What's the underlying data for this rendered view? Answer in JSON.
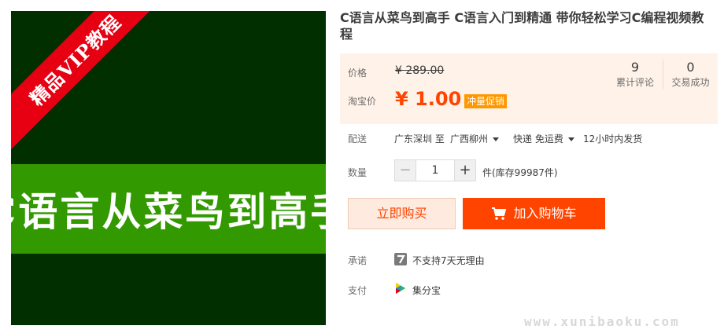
{
  "product_image": {
    "ribbon_text": "精品VIP教程",
    "banner_text": "C语言从菜鸟到高手"
  },
  "title": "C语言从菜鸟到高手 C语言入门到精通 带你轻松学习C编程视频教程",
  "price": {
    "price_label": "价格",
    "original_price": "¥ 289.00",
    "promo_label": "淘宝价",
    "promo_price": "¥ 1.00",
    "promo_tag": "冲量促销"
  },
  "stats": [
    {
      "value": "9",
      "label": "累计评论"
    },
    {
      "value": "0",
      "label": "交易成功"
    }
  ],
  "shipping": {
    "label": "配送",
    "from": "广东深圳 至",
    "to": "广西柳州",
    "method": "快递 免运费",
    "dispatch": "12小时内发货"
  },
  "quantity": {
    "label": "数量",
    "minus": "−",
    "value": "1",
    "plus": "+",
    "stock": "件(库存99987件)"
  },
  "actions": {
    "buy_now": "立即购买",
    "add_to_cart": "加入购物车"
  },
  "promise": {
    "label": "承诺",
    "text": "不支持7天无理由"
  },
  "payment": {
    "label": "支付",
    "text": "集分宝"
  },
  "watermark": "www.xunibaoku.com",
  "colors": {
    "accent": "#ff4400",
    "image_bg": "#012f00",
    "banner_green": "#339900",
    "ribbon_red": "#e60012",
    "price_panel_bg": "#fff2e8"
  }
}
